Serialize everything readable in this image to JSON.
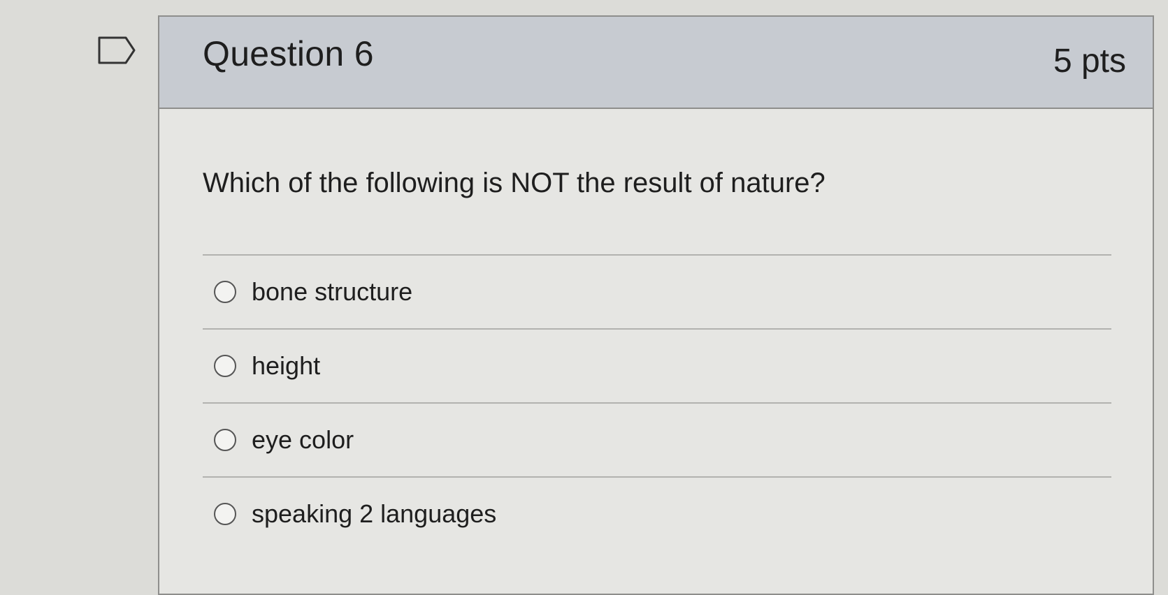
{
  "question": {
    "title": "Question 6",
    "points": "5 pts",
    "prompt": "Which of the following is NOT the result of nature?",
    "answers": [
      {
        "label": "bone structure"
      },
      {
        "label": "height"
      },
      {
        "label": "eye color"
      },
      {
        "label": "speaking 2 languages"
      }
    ]
  },
  "icons": {
    "flag": "flag-question-icon",
    "radio": "radio-button-unselected"
  },
  "colors": {
    "header_background": "#c7cbd1",
    "card_background": "#e6e6e3",
    "border": "#8e8e8c",
    "text": "#1e1e1e"
  }
}
